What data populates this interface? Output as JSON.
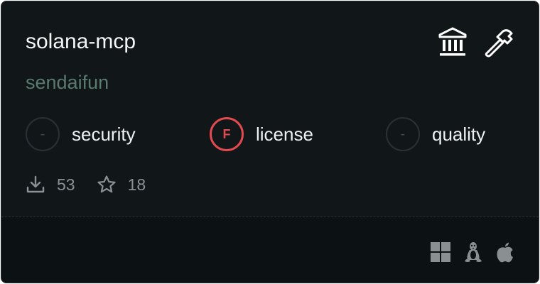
{
  "card": {
    "title": "solana-mcp",
    "author": "sendaifun",
    "header_icons": [
      "bank-icon",
      "hammer-icon"
    ],
    "scores": [
      {
        "label": "security",
        "grade": "-",
        "status": "unknown"
      },
      {
        "label": "license",
        "grade": "F",
        "status": "fail"
      },
      {
        "label": "quality",
        "grade": "-",
        "status": "unknown"
      }
    ],
    "stats": {
      "downloads": "53",
      "stars": "18"
    },
    "platforms": [
      "windows-icon",
      "linux-icon",
      "apple-icon"
    ]
  },
  "colors": {
    "background": "#111719",
    "footer": "#0c1113",
    "author": "#5b7a6f",
    "fail": "#e24a4f",
    "muted": "#8a9194"
  }
}
